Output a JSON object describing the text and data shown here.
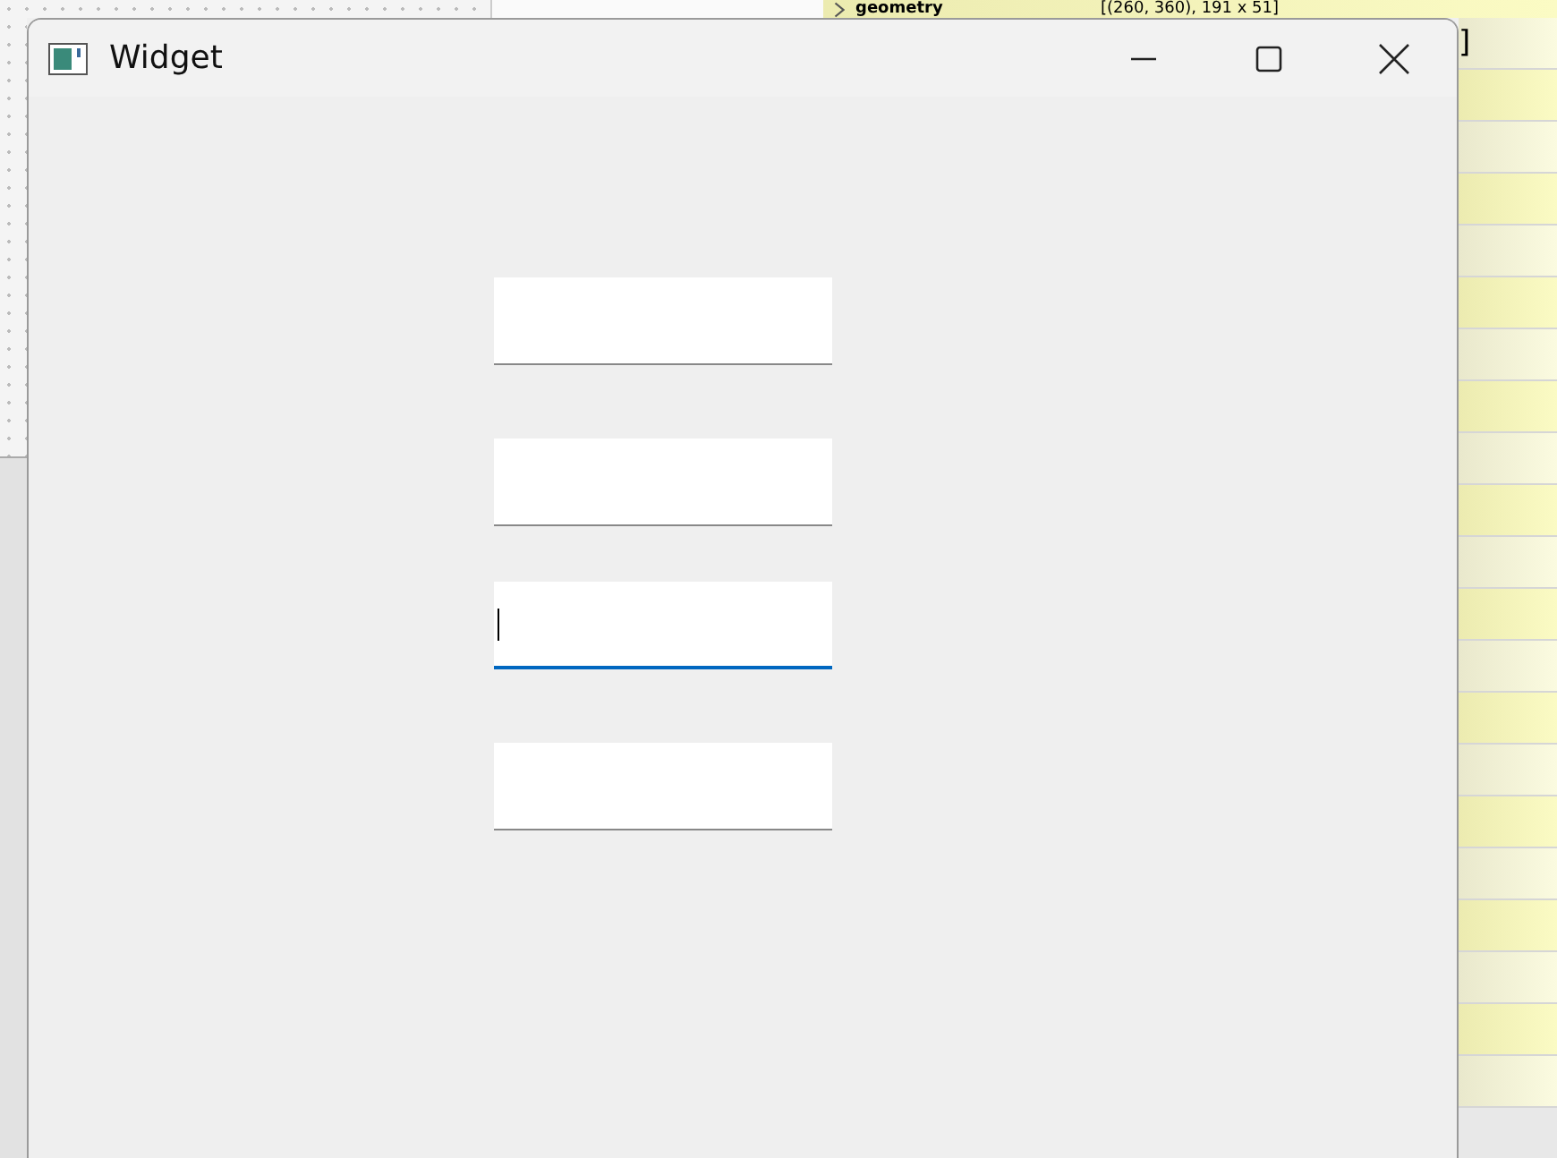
{
  "background": {
    "property_rows": [
      {
        "name": "geometry",
        "value": "[(260, 360), 191 x 51]",
        "expanded": false
      },
      {
        "name": "",
        "value": "]"
      }
    ]
  },
  "window": {
    "title": "Widget"
  },
  "fields": [
    {
      "focused": false
    },
    {
      "focused": false
    },
    {
      "focused": true
    },
    {
      "focused": false
    }
  ]
}
